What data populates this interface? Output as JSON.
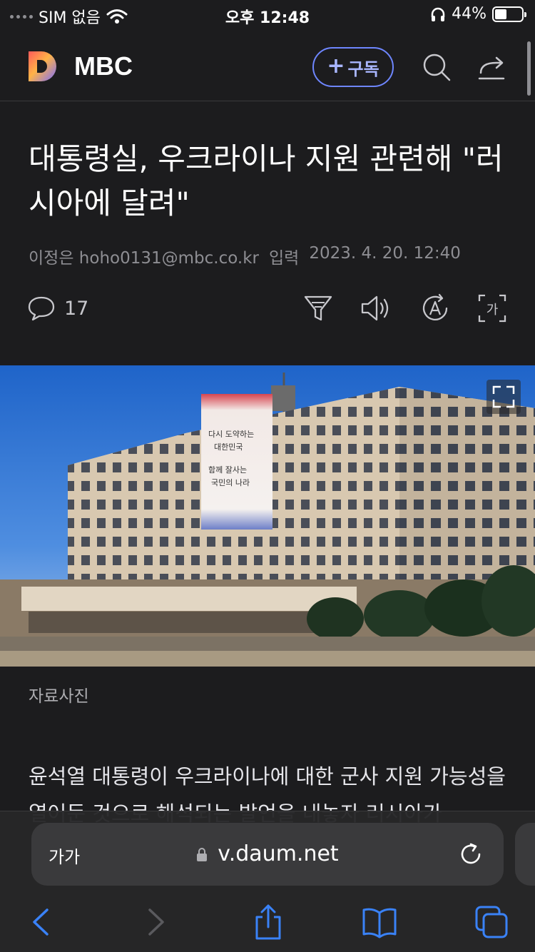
{
  "status_bar": {
    "carrier": "SIM 없음",
    "time": "오후 12:48",
    "battery_percent": "44%",
    "battery_level": 0.44
  },
  "header": {
    "brand": "MBC",
    "subscribe_label": "구독",
    "icons": [
      "daum-logo",
      "search-icon",
      "share-icon"
    ]
  },
  "article": {
    "title": "대통령실, 우크라이나 지원 관련해 \"러시아에 달려\"",
    "author": "이정은 hoho0131@mbc.co.kr",
    "input_label": "입력",
    "datetime": "2023. 4. 20. 12:40",
    "comment_count": "17",
    "tools": [
      "summary-filter-icon",
      "speaker-icon",
      "translate-icon",
      "font-size-icon"
    ],
    "photo_caption": "자료사진",
    "body": "윤석열 대통령이 우크라이나에 대한 군사 지원 가능성을 열어둔 것으로 해석되는 발언을 내놓자 러시아가"
  },
  "safari": {
    "text_size": "가가",
    "url": "v.daum.net",
    "icons": [
      "back-icon",
      "forward-icon",
      "share-icon",
      "bookmarks-icon",
      "tabs-icon"
    ]
  },
  "colors": {
    "background": "#1c1c1e",
    "accent": "#6e86ff",
    "muted": "#8e8e93"
  }
}
